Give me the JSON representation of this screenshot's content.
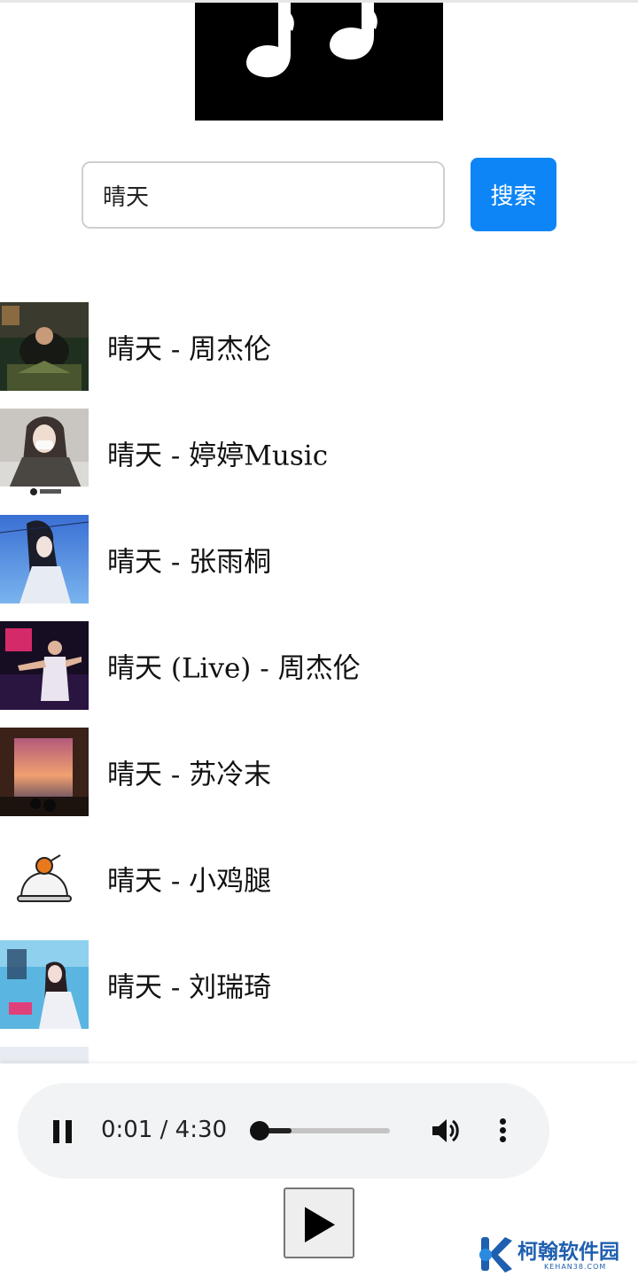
{
  "search": {
    "value": "晴天",
    "button_label": "搜索"
  },
  "results": [
    {
      "title": "晴天 - 周杰伦"
    },
    {
      "title": "晴天 - 婷婷Music"
    },
    {
      "title": "晴天 - 张雨桐"
    },
    {
      "title": "晴天 (Live) - 周杰伦"
    },
    {
      "title": "晴天 - 苏冷末"
    },
    {
      "title": "晴天 - 小鸡腿"
    },
    {
      "title": "晴天 - 刘瑞琦"
    }
  ],
  "player": {
    "time_display": "0:01 / 4:30",
    "progress_fraction": 0.004,
    "buffered_fraction": 0.25
  },
  "watermark": {
    "text": "柯翰软件园",
    "subtext": "KEHAN38.COM"
  },
  "colors": {
    "accent": "#0d85f7",
    "player_background": "#f1f3f4",
    "watermark": "#1f5fb0"
  },
  "icons": {
    "logo": "music-notes-icon",
    "pause": "pause-icon",
    "volume": "volume-icon",
    "more": "more-vertical-icon",
    "play": "play-icon"
  }
}
